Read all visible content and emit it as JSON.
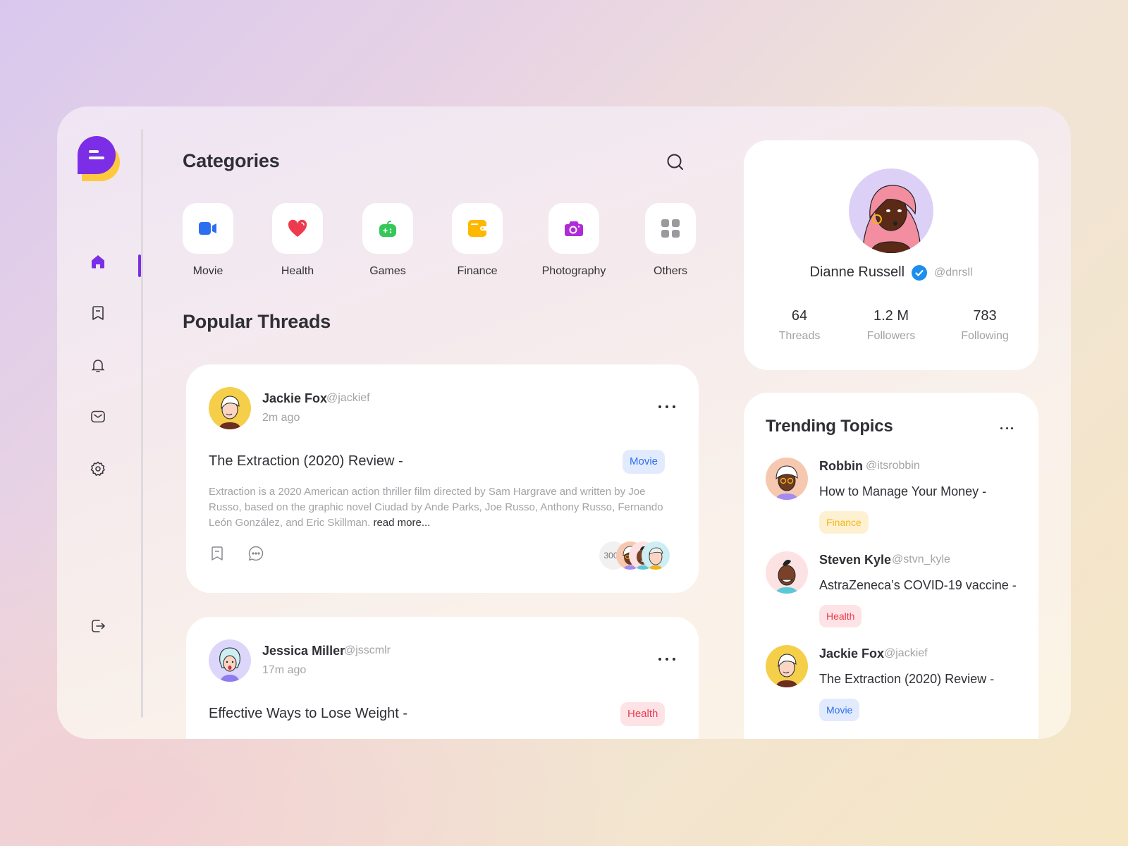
{
  "colors": {
    "brand": "#7b2ee6",
    "brand_secondary": "#ffc93e",
    "movie": "#2d6ef0",
    "health": "#ee3a4f",
    "games": "#35c759",
    "finance": "#ffb800",
    "photography": "#b02bd8",
    "others": "#9a9a9e"
  },
  "sidebar": {
    "items": [
      {
        "name": "home",
        "icon": "home-icon",
        "active": true
      },
      {
        "name": "bookmarks",
        "icon": "bookmark-icon",
        "active": false
      },
      {
        "name": "notifications",
        "icon": "bell-icon",
        "active": false
      },
      {
        "name": "messages",
        "icon": "mail-icon",
        "active": false
      },
      {
        "name": "settings",
        "icon": "gear-icon",
        "active": false
      }
    ],
    "logout_icon": "logout-icon"
  },
  "main": {
    "categories_title": "Categories",
    "search_icon": "search-icon",
    "categories": [
      {
        "label": "Movie",
        "icon": "video-camera-icon"
      },
      {
        "label": "Health",
        "icon": "heart-icon"
      },
      {
        "label": "Games",
        "icon": "gamepad-icon"
      },
      {
        "label": "Finance",
        "icon": "wallet-icon"
      },
      {
        "label": "Photography",
        "icon": "camera-icon"
      },
      {
        "label": "Others",
        "icon": "grid-icon"
      }
    ],
    "threads_title": "Popular Threads",
    "threads": [
      {
        "author": "Jackie Fox",
        "handle": "@jackief",
        "time": "2m ago",
        "title": "The Extraction (2020) Review -",
        "tag": "Movie",
        "body": "Extraction is a 2020 American action thriller film directed by Sam Hargrave and written by Joe Russo, based on the graphic novel Ciudad by Ande Parks, Joe Russo, Anthony Russo, Fernando León González, and Eric Skillman.",
        "read_more": "read more...",
        "participants_count": "300+"
      },
      {
        "author": "Jessica Miller",
        "handle": "@jsscmlr",
        "time": "17m ago",
        "title": "Effective Ways to Lose Weight -",
        "tag": "Health"
      }
    ]
  },
  "profile": {
    "name": "Dianne Russell",
    "handle": "@dnrsll",
    "verified": true,
    "stats": [
      {
        "value": "64",
        "label": "Threads"
      },
      {
        "value": "1.2 M",
        "label": "Followers"
      },
      {
        "value": "783",
        "label": "Following"
      }
    ]
  },
  "trending": {
    "title": "Trending Topics",
    "items": [
      {
        "author": "Robbin",
        "handle": "@itsrobbin",
        "title": "How to Manage Your Money -",
        "tag": "Finance"
      },
      {
        "author": "Steven Kyle",
        "handle": "@stvn_kyle",
        "title": "AstraZeneca’s COVID-19 vaccine -",
        "tag": "Health"
      },
      {
        "author": "Jackie Fox",
        "handle": "@jackief",
        "title": "The Extraction (2020) Review -",
        "tag": "Movie"
      }
    ]
  }
}
